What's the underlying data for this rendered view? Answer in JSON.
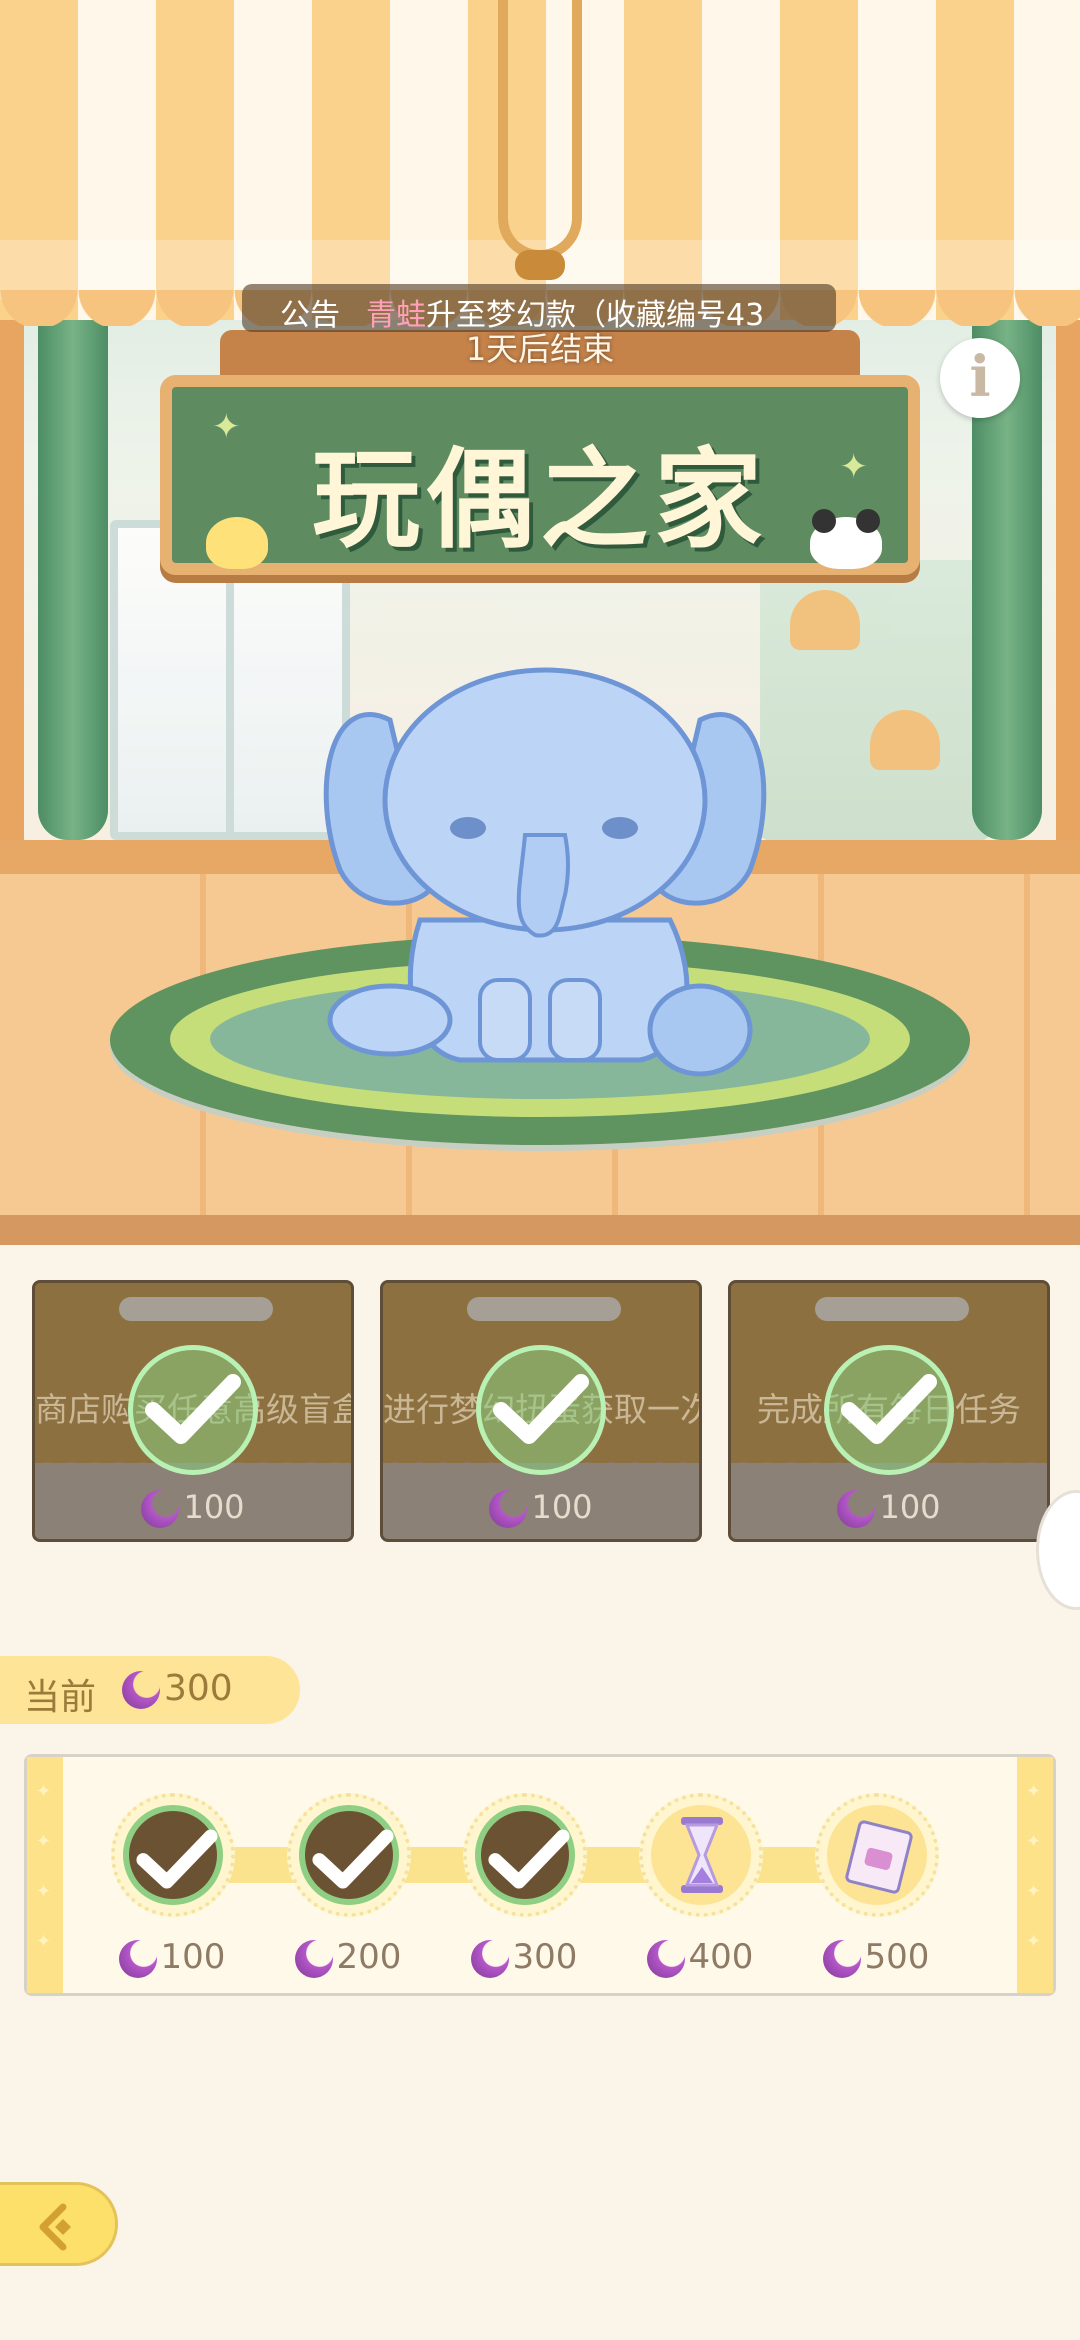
{
  "announcement": {
    "label": "公告",
    "highlight": "青蛙",
    "text": "升至梦幻款（收藏编号43"
  },
  "countdown": "1天后结束",
  "sign": {
    "title": "玩偶之家"
  },
  "info_icon": "i",
  "tasks": [
    {
      "text": "商店购买任意高级盲盒兑换券",
      "reward": "100",
      "completed": true
    },
    {
      "text": "进行梦幻扭蛋获取一次",
      "reward": "100",
      "completed": true
    },
    {
      "text": "完成所有每日任务",
      "reward": "100",
      "completed": true
    }
  ],
  "current": {
    "label": "当前",
    "value": "300"
  },
  "milestones": [
    {
      "value": "100",
      "status": "claimed",
      "icon": "check-icon"
    },
    {
      "value": "200",
      "status": "claimed",
      "icon": "check-icon"
    },
    {
      "value": "300",
      "status": "claimed",
      "icon": "check-icon"
    },
    {
      "value": "400",
      "status": "locked",
      "icon": "hourglass-icon"
    },
    {
      "value": "500",
      "status": "locked",
      "icon": "ticket-icon"
    }
  ],
  "colors": {
    "accent_yellow": "#fde497",
    "check_green": "#8fcf84",
    "moon_purple": "#b557c9",
    "sign_green": "#5e8c60"
  }
}
